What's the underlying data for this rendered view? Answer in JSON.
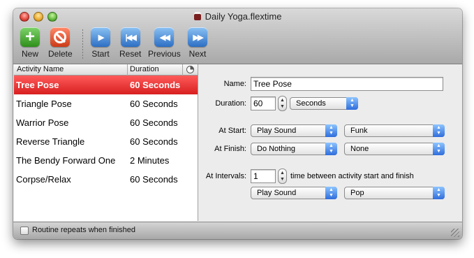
{
  "window": {
    "title": "Daily Yoga.flextime"
  },
  "toolbar": {
    "new_label": "New",
    "delete_label": "Delete",
    "start_label": "Start",
    "reset_label": "Reset",
    "previous_label": "Previous",
    "next_label": "Next"
  },
  "table": {
    "col_name": "Activity Name",
    "col_duration": "Duration",
    "rows": [
      {
        "name": "Tree Pose",
        "duration": "60 Seconds",
        "selected": true
      },
      {
        "name": "Triangle Pose",
        "duration": "60 Seconds"
      },
      {
        "name": "Warrior Pose",
        "duration": "60 Seconds"
      },
      {
        "name": "Reverse Triangle",
        "duration": "60 Seconds"
      },
      {
        "name": "The Bendy Forward One",
        "duration": "2 Minutes"
      },
      {
        "name": "Corpse/Relax",
        "duration": "60 Seconds"
      }
    ]
  },
  "detail": {
    "name_label": "Name:",
    "name_value": "Tree Pose",
    "duration_label": "Duration:",
    "duration_value": "60",
    "duration_unit": "Seconds",
    "at_start_label": "At Start:",
    "at_start_action": "Play Sound",
    "at_start_sound": "Funk",
    "at_finish_label": "At Finish:",
    "at_finish_action": "Do Nothing",
    "at_finish_sound": "None",
    "at_intervals_label": "At Intervals:",
    "intervals_value": "1",
    "intervals_hint": "time between activity start and finish",
    "interval_action": "Play Sound",
    "interval_sound": "Pop"
  },
  "status": {
    "repeat_label": "Routine repeats when finished"
  },
  "colors": {
    "selection": "#e02828",
    "accent_blue": "#2f6ddb"
  }
}
